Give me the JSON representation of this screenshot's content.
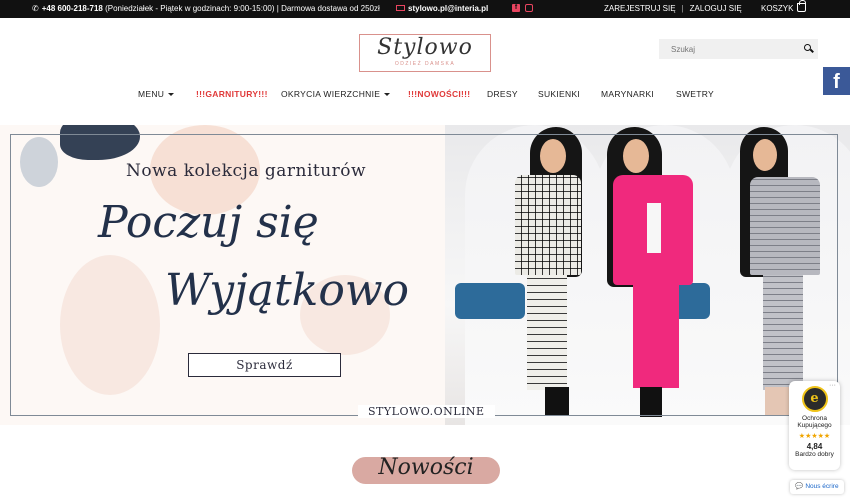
{
  "topbar": {
    "phone": "+48 600-218-718",
    "hours": "(Poniedziałek - Piątek w godzinach: 9:00-15:00) | Darmowa dostawa od 250zł",
    "email": "stylowo.pl@interia.pl",
    "social": [
      "facebook-icon",
      "instagram-icon"
    ],
    "register": "ZAREJESTRUJ SIĘ",
    "login": "ZALOGUJ SIĘ",
    "cart": "KOSZYK"
  },
  "logo": {
    "name": "Stylowo",
    "tagline": "ODZIEŻ DAMSKA"
  },
  "search": {
    "placeholder": "Szukaj"
  },
  "nav": {
    "items": [
      {
        "label": "MENU",
        "dropdown": true,
        "highlight": false
      },
      {
        "label": "!!!GARNITURY!!!",
        "dropdown": false,
        "highlight": true
      },
      {
        "label": "OKRYCIA WIERZCHNIE",
        "dropdown": true,
        "highlight": false
      },
      {
        "label": "!!!NOWOŚCI!!!",
        "dropdown": false,
        "highlight": true
      },
      {
        "label": "DRESY",
        "dropdown": false,
        "highlight": false
      },
      {
        "label": "SUKIENKI",
        "dropdown": false,
        "highlight": false
      },
      {
        "label": "MARYNARKI",
        "dropdown": false,
        "highlight": false
      },
      {
        "label": "SWETRY",
        "dropdown": false,
        "highlight": false
      }
    ]
  },
  "banner": {
    "line1": "Nowa kolekcja garniturów",
    "line2": "Poczuj się",
    "line3": "Wyjątkowo",
    "cta": "Sprawdź",
    "site": "STYLOWO.ONLINE"
  },
  "section": {
    "title": "Nowości"
  },
  "trust_widget": {
    "seal": "e",
    "label": "Ochrona Kupującego",
    "stars": "★★★★★",
    "score": "4,84",
    "rating_text": "Bardzo dobry"
  },
  "chat": {
    "label": "Nous écrire"
  },
  "colors": {
    "accent": "#e03a3a",
    "brand_pink": "#d9918c",
    "facebook": "#3b5998",
    "topbar": "#111111"
  }
}
